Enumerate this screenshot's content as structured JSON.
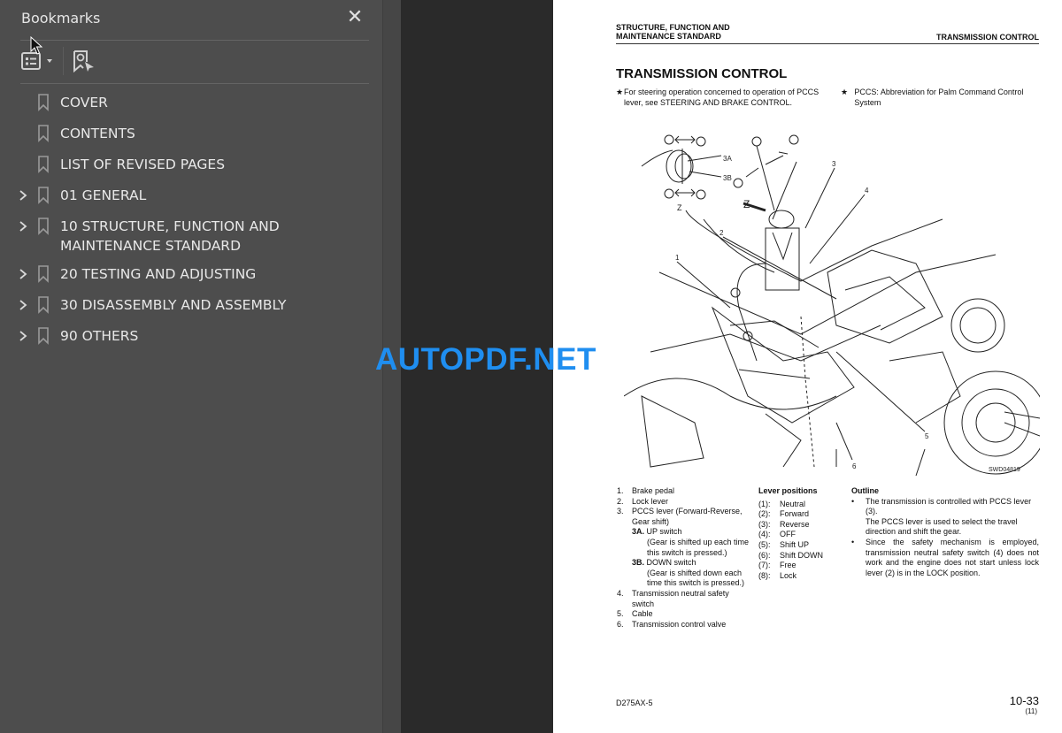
{
  "bookmarks_panel": {
    "title": "Bookmarks",
    "close_label": "✕",
    "items": [
      {
        "label": "COVER",
        "expandable": false
      },
      {
        "label": "CONTENTS",
        "expandable": false
      },
      {
        "label": "LIST OF REVISED PAGES",
        "expandable": false
      },
      {
        "label": "01 GENERAL",
        "expandable": true
      },
      {
        "label": "10 STRUCTURE, FUNCTION AND MAINTENANCE STANDARD",
        "expandable": true
      },
      {
        "label": "20 TESTING AND ADJUSTING",
        "expandable": true
      },
      {
        "label": "30 DISASSEMBLY AND ASSEMBLY",
        "expandable": true
      },
      {
        "label": "90 OTHERS",
        "expandable": true
      }
    ]
  },
  "page": {
    "header_left_line1": "STRUCTURE, FUNCTION AND",
    "header_left_line2": "MAINTENANCE STANDARD",
    "header_right": "TRANSMISSION CONTROL",
    "title": "TRANSMISSION CONTROL",
    "notes": [
      {
        "star": "★",
        "text": "For steering operation concerned to operation of PCCS lever, see STEERING AND BRAKE CONTROL."
      },
      {
        "star": "★",
        "text": "PCCS: Abbreviation for Palm Command Control System"
      }
    ],
    "diagram": {
      "code": "SWD04819",
      "view_label": "Z",
      "callouts": [
        "1",
        "2",
        "3",
        "4",
        "5",
        "6",
        "3A",
        "3B"
      ],
      "position_markers": [
        "①",
        "②",
        "③",
        "④",
        "⑤",
        "⑥",
        "⑦",
        "⑧"
      ]
    },
    "parts": [
      {
        "num": "1.",
        "text": "Brake pedal"
      },
      {
        "num": "2.",
        "text": "Lock lever"
      },
      {
        "num": "3.",
        "text": "PCCS lever (Forward-Reverse, Gear shift)"
      },
      {
        "num": "3A.",
        "text": "UP switch",
        "sub": "(Gear is shifted up each time this switch is pressed.)"
      },
      {
        "num": "3B.",
        "text": "DOWN switch",
        "sub": "(Gear is shifted down each time this switch is pressed.)"
      },
      {
        "num": "4.",
        "text": "Transmission neutral safety switch"
      },
      {
        "num": "5.",
        "text": "Cable"
      },
      {
        "num": "6.",
        "text": "Transmission control valve"
      }
    ],
    "lever_positions": {
      "heading": "Lever positions",
      "items": [
        {
          "key": "(1):",
          "value": "Neutral"
        },
        {
          "key": "(2):",
          "value": "Forward"
        },
        {
          "key": "(3):",
          "value": "Reverse"
        },
        {
          "key": "(4):",
          "value": "OFF"
        },
        {
          "key": "(5):",
          "value": "Shift UP"
        },
        {
          "key": "(6):",
          "value": "Shift DOWN"
        },
        {
          "key": "(7):",
          "value": "Free"
        },
        {
          "key": "(8):",
          "value": "Lock"
        }
      ]
    },
    "outline": {
      "heading": "Outline",
      "bullets": [
        {
          "text": "The transmission is controlled with PCCS lever (3).",
          "extra": "The PCCS lever is used to select the travel direction and shift the gear."
        },
        {
          "text": "Since the safety mechanism is employed, transmission neutral safety switch (4) does not work and the engine does not start unless lock lever (2) is in the LOCK position.",
          "extra": ""
        }
      ]
    },
    "footer_left": "D275AX-5",
    "page_number": "10-33",
    "revision": "(11)"
  },
  "watermark": "AUTOPDF.NET",
  "colors": {
    "panel_bg": "#4d4d4d",
    "viewer_bg": "#2a2a2a",
    "watermark": "#1f8ef0"
  }
}
